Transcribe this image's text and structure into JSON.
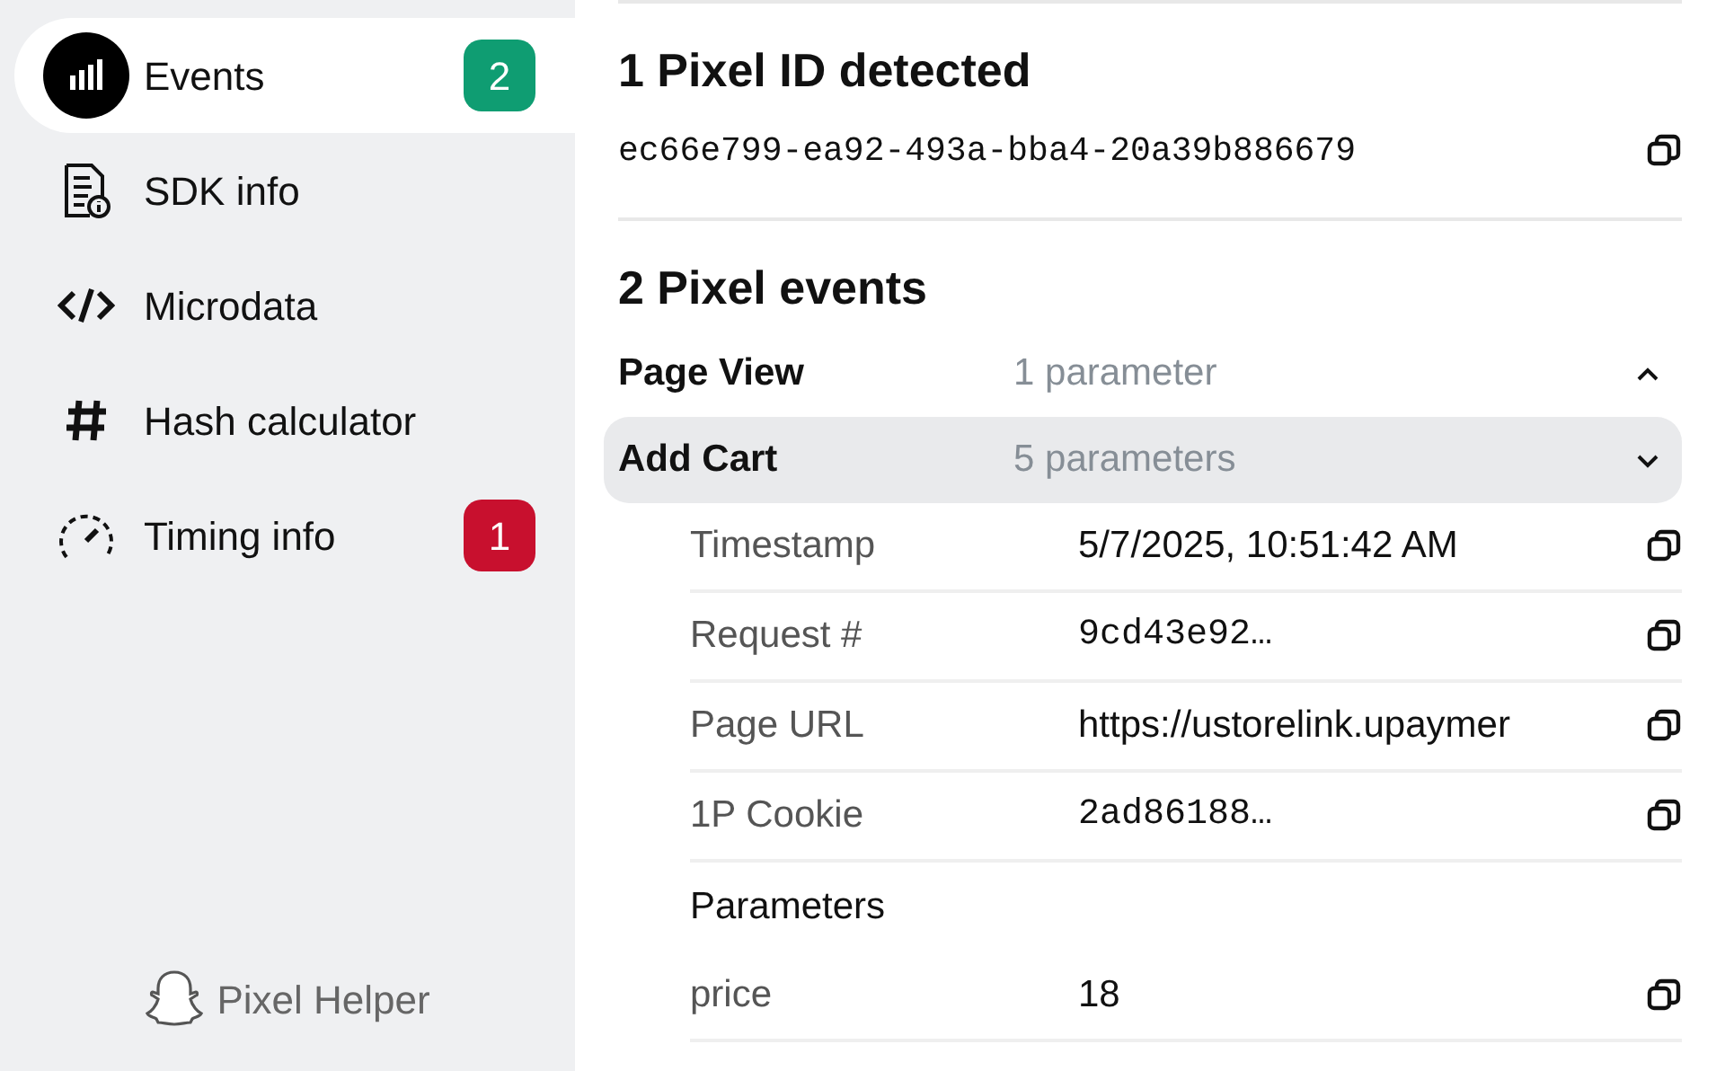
{
  "sidebar": {
    "items": [
      {
        "label": "Events",
        "selected": true,
        "badge": "2",
        "color": "#0f9d72"
      },
      {
        "label": "SDK info",
        "selected": false
      },
      {
        "label": "Microdata",
        "selected": false
      },
      {
        "label": "Hash calculator",
        "selected": false
      },
      {
        "label": "Timing info",
        "selected": false,
        "badge": "1",
        "color": "#c8102e"
      }
    ],
    "footer": "Pixel Helper"
  },
  "pixel_ids": {
    "title": "1 Pixel ID detected",
    "ids": [
      "ec66e799-ea92-493a-bba4-20a39b886679"
    ]
  },
  "events": {
    "title": "2 Pixel events",
    "items": [
      {
        "name": "Page View",
        "count": "1 parameter",
        "expanded": false,
        "selected": false
      },
      {
        "name": "Add Cart",
        "count": "5 parameters",
        "expanded": true,
        "selected": true,
        "details": [
          {
            "kind": "field",
            "label": "Timestamp",
            "value": "5/7/2025, 10:51:42 AM"
          },
          {
            "kind": "code",
            "label": "Request #",
            "value": "9cd43e92…"
          },
          {
            "kind": "field",
            "label": "Page URL",
            "value": "https://ustorelink.upaymer"
          },
          {
            "kind": "code",
            "label": "1P Cookie",
            "value": "2ad86188…"
          },
          {
            "kind": "section",
            "label": "Parameters"
          },
          {
            "kind": "field",
            "label": "price",
            "value": "18"
          }
        ]
      }
    ]
  }
}
